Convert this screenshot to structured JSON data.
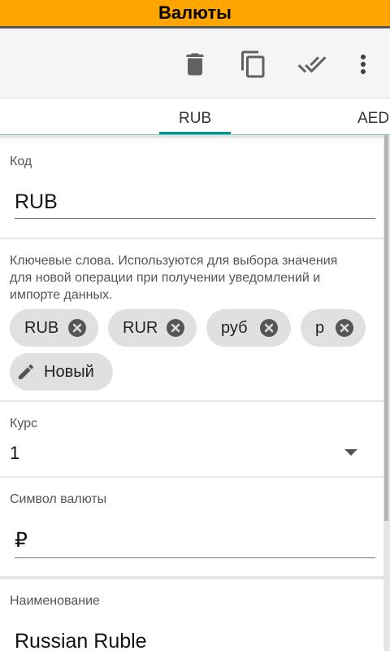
{
  "title_bar": {
    "title": "Валюты",
    "color": "#ffa500"
  },
  "toolbar": {
    "icons": [
      "delete-icon",
      "copy-icon",
      "done-all-icon",
      "more-vert-icon"
    ]
  },
  "tabs": {
    "items": [
      {
        "label": "RUB",
        "selected": true
      },
      {
        "label": "AED",
        "selected": false
      }
    ],
    "accent": "#009688"
  },
  "code_card": {
    "label": "Код",
    "value": "RUB"
  },
  "keywords_card": {
    "description": "Ключевые слова. Используются для выбора значения для новой операции при получении уведомлений и импорте данных.",
    "chips": [
      {
        "label": "RUB"
      },
      {
        "label": "RUR"
      },
      {
        "label": "руб"
      },
      {
        "label": "р"
      }
    ],
    "new_chip": {
      "label": "Новый",
      "icon": "edit-icon"
    }
  },
  "rate_card": {
    "label": "Курс",
    "value": "1"
  },
  "symbol_card": {
    "label": "Символ валюты",
    "value": "₽"
  },
  "name_card": {
    "label": "Наименование",
    "value": "Russian Ruble"
  }
}
